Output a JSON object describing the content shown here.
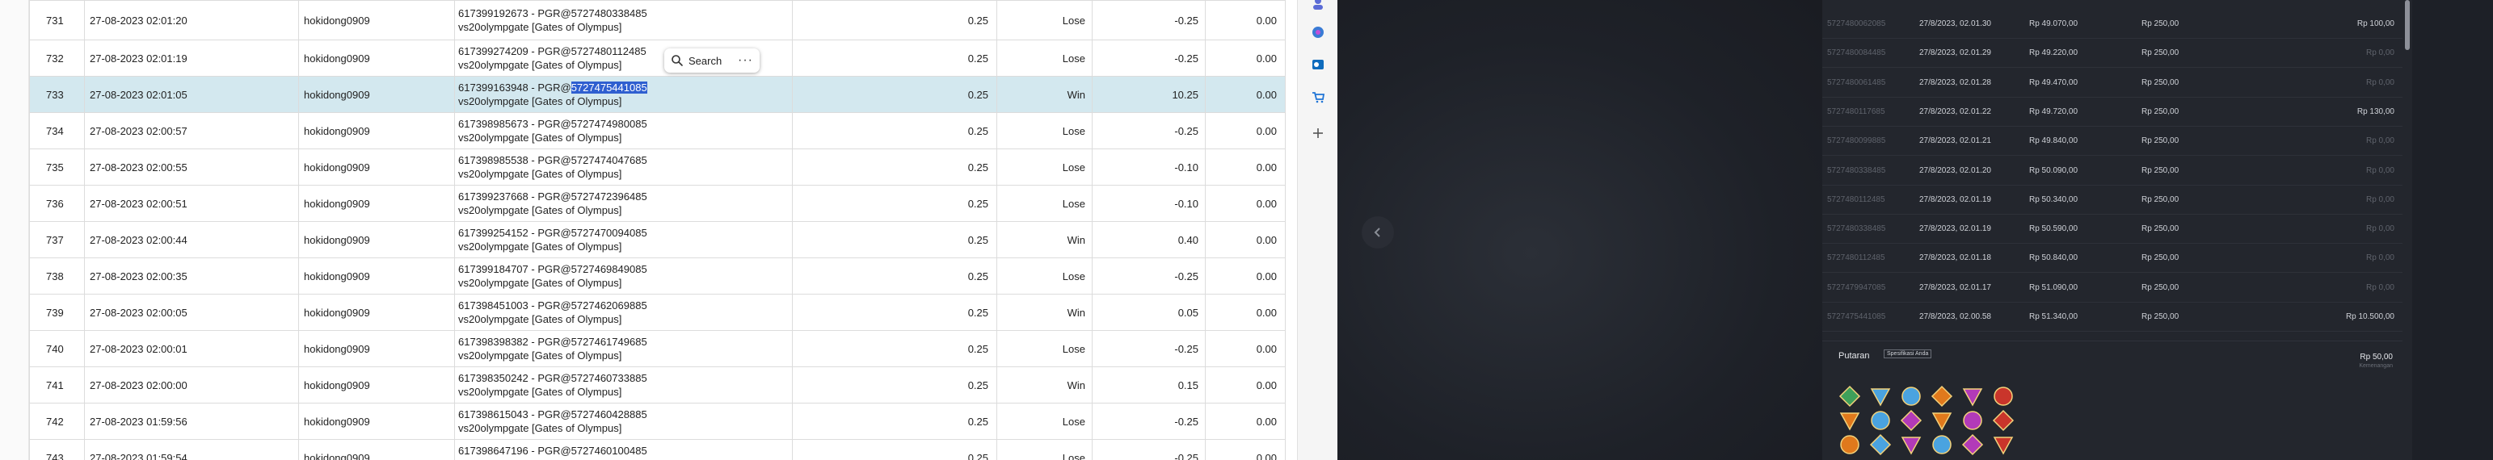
{
  "table": {
    "rows": [
      {
        "id": "731",
        "time": "27-08-2023 02:01:20",
        "user": "hokidong0909",
        "desc1": "617399192673 - PGR@5727480338485",
        "desc2": "vs20olympgate [Gates of Olympus]",
        "bet": "0.25",
        "result": "Lose",
        "win": "-0.25",
        "jp": "0.00"
      },
      {
        "id": "732",
        "time": "27-08-2023 02:01:19",
        "user": "hokidong0909",
        "desc1": "617399274209 - PGR@5727480112485",
        "desc2": "vs20olympgate [Gates of Olympus]",
        "bet": "0.25",
        "result": "Lose",
        "win": "-0.25",
        "jp": "0.00"
      },
      {
        "id": "733",
        "time": "27-08-2023 02:01:05",
        "user": "hokidong0909",
        "desc1": "617399163948 - PGR@",
        "desc1_highlight": "5727475441085",
        "desc2": "vs20olympgate [Gates of Olympus]",
        "bet": "0.25",
        "result": "Win",
        "win": "10.25",
        "jp": "0.00",
        "selected": true
      },
      {
        "id": "734",
        "time": "27-08-2023 02:00:57",
        "user": "hokidong0909",
        "desc1": "617398985673 - PGR@5727474980085",
        "desc2": "vs20olympgate [Gates of Olympus]",
        "bet": "0.25",
        "result": "Lose",
        "win": "-0.25",
        "jp": "0.00"
      },
      {
        "id": "735",
        "time": "27-08-2023 02:00:55",
        "user": "hokidong0909",
        "desc1": "617398985538 - PGR@5727474047685",
        "desc2": "vs20olympgate [Gates of Olympus]",
        "bet": "0.25",
        "result": "Lose",
        "win": "-0.10",
        "jp": "0.00"
      },
      {
        "id": "736",
        "time": "27-08-2023 02:00:51",
        "user": "hokidong0909",
        "desc1": "617399237668 - PGR@5727472396485",
        "desc2": "vs20olympgate [Gates of Olympus]",
        "bet": "0.25",
        "result": "Lose",
        "win": "-0.10",
        "jp": "0.00"
      },
      {
        "id": "737",
        "time": "27-08-2023 02:00:44",
        "user": "hokidong0909",
        "desc1": "617399254152 - PGR@5727470094085",
        "desc2": "vs20olympgate [Gates of Olympus]",
        "bet": "0.25",
        "result": "Win",
        "win": "0.40",
        "jp": "0.00"
      },
      {
        "id": "738",
        "time": "27-08-2023 02:00:35",
        "user": "hokidong0909",
        "desc1": "617399184707 - PGR@5727469849085",
        "desc2": "vs20olympgate [Gates of Olympus]",
        "bet": "0.25",
        "result": "Lose",
        "win": "-0.25",
        "jp": "0.00"
      },
      {
        "id": "739",
        "time": "27-08-2023 02:00:05",
        "user": "hokidong0909",
        "desc1": "617398451003 - PGR@5727462069885",
        "desc2": "vs20olympgate [Gates of Olympus]",
        "bet": "0.25",
        "result": "Win",
        "win": "0.05",
        "jp": "0.00"
      },
      {
        "id": "740",
        "time": "27-08-2023 02:00:01",
        "user": "hokidong0909",
        "desc1": "617398398382 - PGR@5727461749685",
        "desc2": "vs20olympgate [Gates of Olympus]",
        "bet": "0.25",
        "result": "Lose",
        "win": "-0.25",
        "jp": "0.00"
      },
      {
        "id": "741",
        "time": "27-08-2023 02:00:00",
        "user": "hokidong0909",
        "desc1": "617398350242 - PGR@5727460733885",
        "desc2": "vs20olympgate [Gates of Olympus]",
        "bet": "0.25",
        "result": "Win",
        "win": "0.15",
        "jp": "0.00"
      },
      {
        "id": "742",
        "time": "27-08-2023 01:59:56",
        "user": "hokidong0909",
        "desc1": "617398615043 - PGR@5727460428885",
        "desc2": "vs20olympgate [Gates of Olympus]",
        "bet": "0.25",
        "result": "Lose",
        "win": "-0.25",
        "jp": "0.00"
      },
      {
        "id": "743",
        "time": "27-08-2023 01:59:54",
        "user": "hokidong0909",
        "desc1": "617398647196 - PGR@5727460100485",
        "desc2": "vs20olympgate [Gates of Olympus]",
        "bet": "0.25",
        "result": "Lose",
        "win": "-0.25",
        "jp": "0.00"
      }
    ]
  },
  "search_popup": {
    "label": "Search",
    "more": "···"
  },
  "sidebar": {
    "icons": [
      "user-icon",
      "copilot-icon",
      "outlook-icon",
      "shopping-icon",
      "add-icon"
    ]
  },
  "history": {
    "rows": [
      {
        "id": "5727480062085",
        "date": "27/8/2023, 02.01.30",
        "balance": "Rp 49.070,00",
        "bet": "Rp 250,00",
        "win": "Rp 100,00"
      },
      {
        "id": "5727480084485",
        "date": "27/8/2023, 02.01.29",
        "balance": "Rp 49.220,00",
        "bet": "Rp 250,00",
        "win": "Rp 0,00"
      },
      {
        "id": "5727480061485",
        "date": "27/8/2023, 02.01.28",
        "balance": "Rp 49.470,00",
        "bet": "Rp 250,00",
        "win": "Rp 0,00"
      },
      {
        "id": "5727480117685",
        "date": "27/8/2023, 02.01.22",
        "balance": "Rp 49.720,00",
        "bet": "Rp 250,00",
        "win": "Rp 130,00"
      },
      {
        "id": "5727480099885",
        "date": "27/8/2023, 02.01.21",
        "balance": "Rp 49.840,00",
        "bet": "Rp 250,00",
        "win": "Rp 0,00"
      },
      {
        "id": "5727480338485",
        "date": "27/8/2023, 02.01.20",
        "balance": "Rp 50.090,00",
        "bet": "Rp 250,00",
        "win": "Rp 0,00"
      },
      {
        "id": "5727480112485",
        "date": "27/8/2023, 02.01.19",
        "balance": "Rp 50.340,00",
        "bet": "Rp 250,00",
        "win": "Rp 0,00"
      },
      {
        "id": "5727480338485",
        "date": "27/8/2023, 02.01.19",
        "balance": "Rp 50.590,00",
        "bet": "Rp 250,00",
        "win": "Rp 0,00"
      },
      {
        "id": "5727480112485",
        "date": "27/8/2023, 02.01.18",
        "balance": "Rp 50.840,00",
        "bet": "Rp 250,00",
        "win": "Rp 0,00"
      },
      {
        "id": "5727479947085",
        "date": "27/8/2023, 02.01.17",
        "balance": "Rp 51.090,00",
        "bet": "Rp 250,00",
        "win": "Rp 0,00"
      },
      {
        "id": "5727475441085",
        "date": "27/8/2023, 02.00.58",
        "balance": "Rp 51.340,00",
        "bet": "Rp 250,00",
        "win": "Rp 10.500,00"
      }
    ]
  },
  "round": {
    "title": "Putaran",
    "tag": "Spesifikasi Anda",
    "amount": "Rp 50,00",
    "sub": "Kemenangan"
  },
  "colors": {
    "lose": "#d32f2f",
    "win": "#2e9b2e",
    "selected_row": "#d3e8ef",
    "highlight": "#2f5fd0"
  }
}
